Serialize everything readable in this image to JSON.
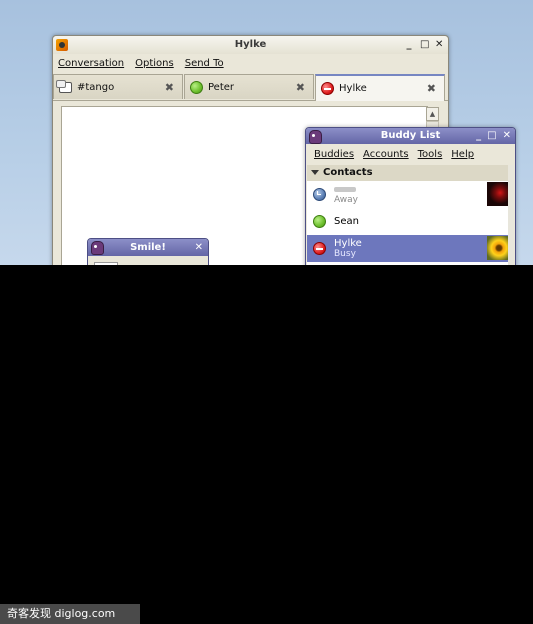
{
  "conversation_window": {
    "title": "Hylke",
    "menu": [
      "Conversation",
      "Options",
      "Send To"
    ],
    "tabs": [
      {
        "label": "#tango",
        "icon": "chat-icon"
      },
      {
        "label": "Peter",
        "icon": "available-status-icon"
      },
      {
        "label": "Hylke",
        "icon": "busy-status-icon",
        "active": true
      }
    ]
  },
  "smile_dialog": {
    "title": "Smile!"
  },
  "buddy_list": {
    "title": "Buddy List",
    "menu": [
      "Buddies",
      "Accounts",
      "Tools",
      "Help"
    ],
    "group": "Contacts",
    "buddies": [
      {
        "name": "",
        "status": "Away",
        "icon": "away-status-icon"
      },
      {
        "name": "Sean",
        "status": "",
        "icon": "available-status-icon"
      },
      {
        "name": "Hylke",
        "status": "Busy",
        "icon": "busy-status-icon"
      }
    ]
  },
  "watermark": "奇客发现 diglog.com",
  "colors": {
    "selection": "#6d77bd",
    "title_purple": "#6466a6",
    "available": "#6cbf2c",
    "busy": "#e02020",
    "away": "#5b7fb5"
  }
}
